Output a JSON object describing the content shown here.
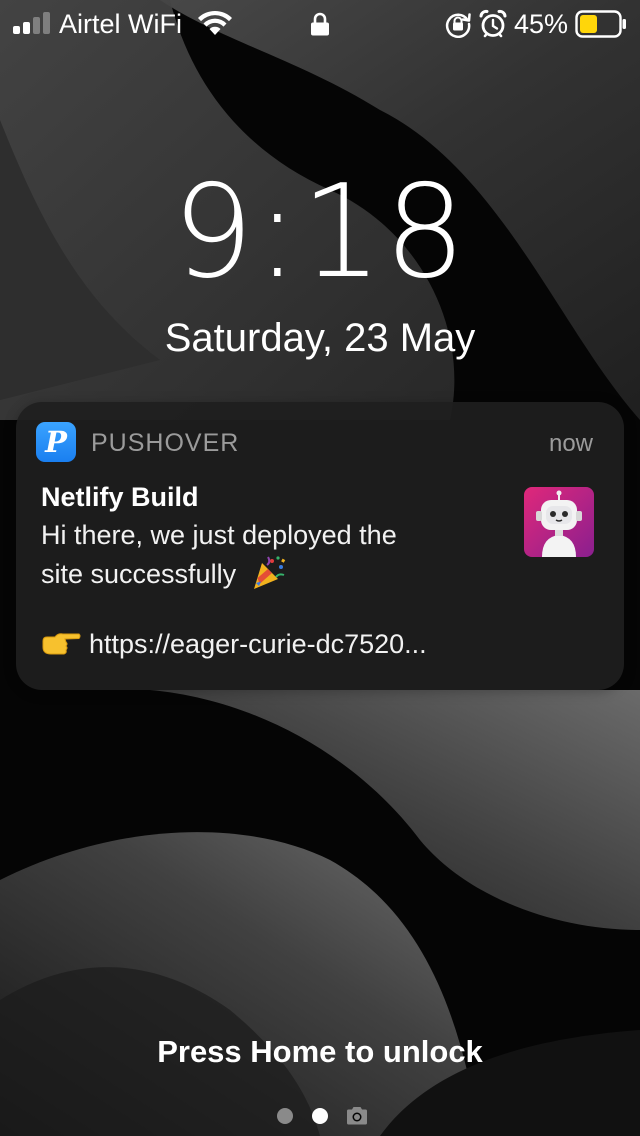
{
  "status_bar": {
    "carrier": "Airtel WiFi",
    "battery_percent": "45%",
    "signal_icon": "cellular-signal-icon",
    "wifi_icon": "wifi-icon",
    "lock_icon": "lock-icon",
    "rotation_lock_icon": "rotation-lock-icon",
    "alarm_icon": "alarm-clock-icon",
    "battery_icon": "battery-icon",
    "battery_level": 0.45,
    "battery_color": "#ffd60a"
  },
  "lockscreen": {
    "time": "9:18",
    "date": "Saturday, 23 May",
    "unlock_hint": "Press Home to unlock"
  },
  "notification": {
    "app_name": "PUSHOVER",
    "app_icon": "pushover-app-icon",
    "app_icon_letter": "P",
    "app_icon_color": "#2a8ff7",
    "timestamp": "now",
    "title": "Netlify Build",
    "body_line_1": "Hi there, we just deployed the",
    "body_line_2": "site successfully",
    "body_emoji": "party-popper-emoji",
    "link_emoji": "pointing-hand-emoji",
    "link_text": "https://eager-curie-dc7520...",
    "thumbnail": "robot-avatar-image",
    "thumbnail_color": "#c2187d"
  },
  "page_indicator": {
    "pages": 2,
    "current_page": 2,
    "camera_icon": "camera-icon"
  }
}
